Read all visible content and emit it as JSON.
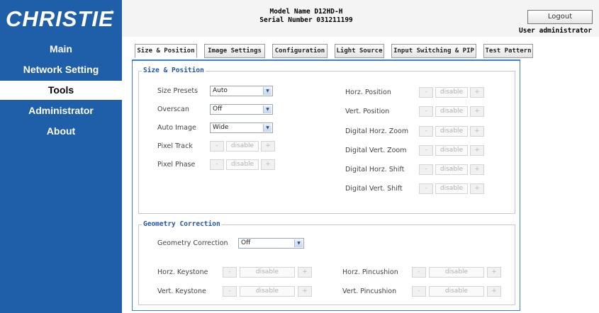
{
  "brand": {
    "logo_text": "CHRISTIE",
    "registered": "®"
  },
  "header": {
    "model_line": "Model Name D12HD-H",
    "serial_line": "Serial Number 031211199",
    "logout_label": "Logout",
    "user_label": "User administrator"
  },
  "nav": {
    "items": [
      {
        "label": "Main"
      },
      {
        "label": "Network Setting"
      },
      {
        "label": "Tools",
        "active": true
      },
      {
        "label": "Administrator"
      },
      {
        "label": "About"
      }
    ]
  },
  "tabs": [
    {
      "label": "Size & Position",
      "active": true
    },
    {
      "label": "Image Settings"
    },
    {
      "label": "Configuration"
    },
    {
      "label": "Light Source"
    },
    {
      "label": "Input Switching & PIP"
    },
    {
      "label": "Test Pattern"
    }
  ],
  "size_position": {
    "title": "Size & Position",
    "left": [
      {
        "label": "Size Presets",
        "type": "select",
        "value": "Auto"
      },
      {
        "label": "Overscan",
        "type": "select",
        "value": "Off"
      },
      {
        "label": "Auto Image",
        "type": "select",
        "value": "Wide"
      },
      {
        "label": "Pixel Track",
        "type": "stepper",
        "value": "disable"
      },
      {
        "label": "Pixel Phase",
        "type": "stepper",
        "value": "disable"
      }
    ],
    "right": [
      {
        "label": "Horz. Position",
        "value": "disable"
      },
      {
        "label": "Vert. Position",
        "value": "disable"
      },
      {
        "label": "Digital Horz. Zoom",
        "value": "disable"
      },
      {
        "label": "Digital Vert. Zoom",
        "value": "disable"
      },
      {
        "label": "Digital Horz. Shift",
        "value": "disable"
      },
      {
        "label": "Digital Vert. Shift",
        "value": "disable"
      }
    ]
  },
  "geometry": {
    "title": "Geometry Correction",
    "correction_label": "Geometry Correction",
    "correction_value": "Off",
    "rows": [
      {
        "left_label": "Horz. Keystone",
        "left_value": "disable",
        "right_label": "Horz. Pincushion",
        "right_value": "disable"
      },
      {
        "left_label": "Vert. Keystone",
        "left_value": "disable",
        "right_label": "Vert. Pincushion",
        "right_value": "disable"
      }
    ]
  },
  "stepper": {
    "minus": "-",
    "plus": "+"
  },
  "icons": {
    "dropdown": "chevron-down-icon"
  },
  "colors": {
    "sidebar": "#1f5ea9",
    "accent": "#3a7fd0",
    "group_title": "#2255aa"
  }
}
